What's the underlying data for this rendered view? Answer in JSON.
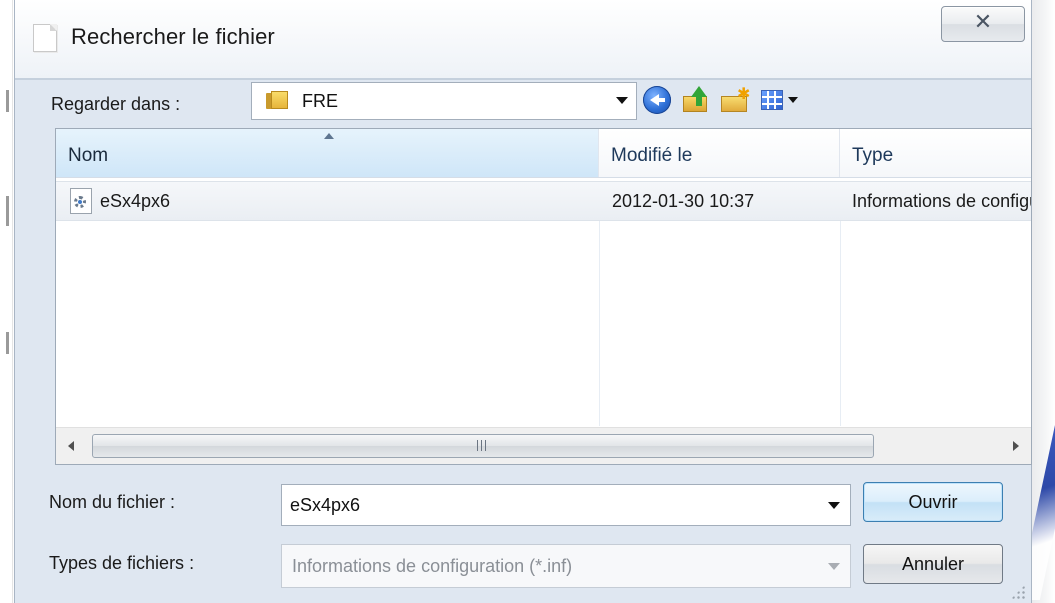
{
  "window": {
    "title": "Rechercher le fichier",
    "close_glyph": "✕",
    "icons": {
      "window_icon": "blank-document-icon",
      "close": "close-icon"
    }
  },
  "location": {
    "label": "Regarder dans :",
    "value": "FRE",
    "icons": {
      "folder": "folder-icon",
      "back": "back-arrow-icon",
      "up": "up-folder-icon",
      "new_folder": "new-folder-icon",
      "view_menu": "view-menu-icon"
    }
  },
  "file_list": {
    "columns": [
      {
        "label": "Nom"
      },
      {
        "label": "Modifié le"
      },
      {
        "label": "Type"
      }
    ],
    "sorted_column": "Nom",
    "sort_direction": "ascending",
    "rows": [
      {
        "name": "eSx4px6",
        "modified": "2012-01-30 10:37",
        "type": "Informations de configuration",
        "icon": "config-file-icon",
        "selected": true
      }
    ],
    "scrollbar": {
      "grip_glyph": "III"
    }
  },
  "filename": {
    "label": "Nom du fichier :",
    "value": "eSx4px6"
  },
  "filetype": {
    "label": "Types de fichiers :",
    "value": "Informations de configuration (*.inf)",
    "enabled": false
  },
  "buttons": {
    "open": "Ouvrir",
    "cancel": "Annuler"
  },
  "colors": {
    "dialog_background": "#dfe7f1",
    "selected_header": "#cfe6f8",
    "default_button_border": "#3c7fb1"
  }
}
